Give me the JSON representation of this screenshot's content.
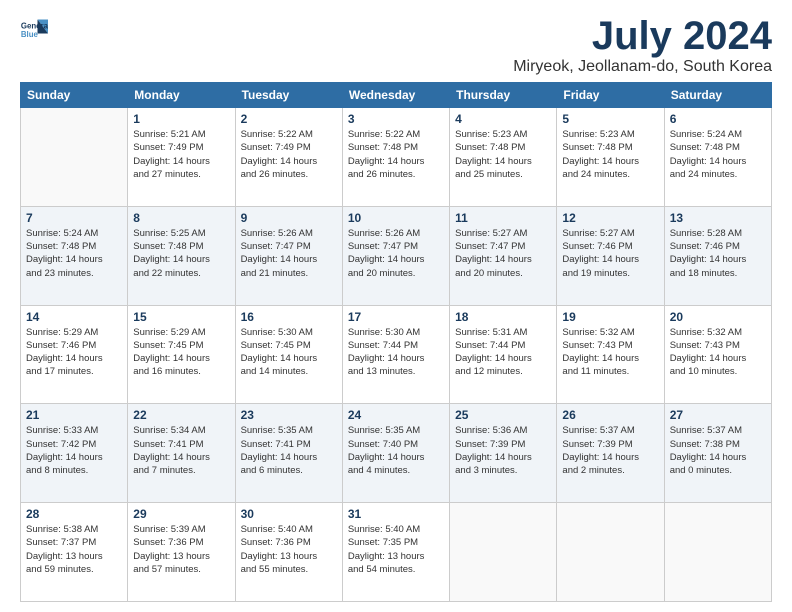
{
  "logo": {
    "line1": "General",
    "line2": "Blue"
  },
  "title": "July 2024",
  "subtitle": "Miryeok, Jeollanam-do, South Korea",
  "weekdays": [
    "Sunday",
    "Monday",
    "Tuesday",
    "Wednesday",
    "Thursday",
    "Friday",
    "Saturday"
  ],
  "weeks": [
    [
      {
        "day": "",
        "info": ""
      },
      {
        "day": "1",
        "info": "Sunrise: 5:21 AM\nSunset: 7:49 PM\nDaylight: 14 hours\nand 27 minutes."
      },
      {
        "day": "2",
        "info": "Sunrise: 5:22 AM\nSunset: 7:49 PM\nDaylight: 14 hours\nand 26 minutes."
      },
      {
        "day": "3",
        "info": "Sunrise: 5:22 AM\nSunset: 7:48 PM\nDaylight: 14 hours\nand 26 minutes."
      },
      {
        "day": "4",
        "info": "Sunrise: 5:23 AM\nSunset: 7:48 PM\nDaylight: 14 hours\nand 25 minutes."
      },
      {
        "day": "5",
        "info": "Sunrise: 5:23 AM\nSunset: 7:48 PM\nDaylight: 14 hours\nand 24 minutes."
      },
      {
        "day": "6",
        "info": "Sunrise: 5:24 AM\nSunset: 7:48 PM\nDaylight: 14 hours\nand 24 minutes."
      }
    ],
    [
      {
        "day": "7",
        "info": "Sunrise: 5:24 AM\nSunset: 7:48 PM\nDaylight: 14 hours\nand 23 minutes."
      },
      {
        "day": "8",
        "info": "Sunrise: 5:25 AM\nSunset: 7:48 PM\nDaylight: 14 hours\nand 22 minutes."
      },
      {
        "day": "9",
        "info": "Sunrise: 5:26 AM\nSunset: 7:47 PM\nDaylight: 14 hours\nand 21 minutes."
      },
      {
        "day": "10",
        "info": "Sunrise: 5:26 AM\nSunset: 7:47 PM\nDaylight: 14 hours\nand 20 minutes."
      },
      {
        "day": "11",
        "info": "Sunrise: 5:27 AM\nSunset: 7:47 PM\nDaylight: 14 hours\nand 20 minutes."
      },
      {
        "day": "12",
        "info": "Sunrise: 5:27 AM\nSunset: 7:46 PM\nDaylight: 14 hours\nand 19 minutes."
      },
      {
        "day": "13",
        "info": "Sunrise: 5:28 AM\nSunset: 7:46 PM\nDaylight: 14 hours\nand 18 minutes."
      }
    ],
    [
      {
        "day": "14",
        "info": "Sunrise: 5:29 AM\nSunset: 7:46 PM\nDaylight: 14 hours\nand 17 minutes."
      },
      {
        "day": "15",
        "info": "Sunrise: 5:29 AM\nSunset: 7:45 PM\nDaylight: 14 hours\nand 16 minutes."
      },
      {
        "day": "16",
        "info": "Sunrise: 5:30 AM\nSunset: 7:45 PM\nDaylight: 14 hours\nand 14 minutes."
      },
      {
        "day": "17",
        "info": "Sunrise: 5:30 AM\nSunset: 7:44 PM\nDaylight: 14 hours\nand 13 minutes."
      },
      {
        "day": "18",
        "info": "Sunrise: 5:31 AM\nSunset: 7:44 PM\nDaylight: 14 hours\nand 12 minutes."
      },
      {
        "day": "19",
        "info": "Sunrise: 5:32 AM\nSunset: 7:43 PM\nDaylight: 14 hours\nand 11 minutes."
      },
      {
        "day": "20",
        "info": "Sunrise: 5:32 AM\nSunset: 7:43 PM\nDaylight: 14 hours\nand 10 minutes."
      }
    ],
    [
      {
        "day": "21",
        "info": "Sunrise: 5:33 AM\nSunset: 7:42 PM\nDaylight: 14 hours\nand 8 minutes."
      },
      {
        "day": "22",
        "info": "Sunrise: 5:34 AM\nSunset: 7:41 PM\nDaylight: 14 hours\nand 7 minutes."
      },
      {
        "day": "23",
        "info": "Sunrise: 5:35 AM\nSunset: 7:41 PM\nDaylight: 14 hours\nand 6 minutes."
      },
      {
        "day": "24",
        "info": "Sunrise: 5:35 AM\nSunset: 7:40 PM\nDaylight: 14 hours\nand 4 minutes."
      },
      {
        "day": "25",
        "info": "Sunrise: 5:36 AM\nSunset: 7:39 PM\nDaylight: 14 hours\nand 3 minutes."
      },
      {
        "day": "26",
        "info": "Sunrise: 5:37 AM\nSunset: 7:39 PM\nDaylight: 14 hours\nand 2 minutes."
      },
      {
        "day": "27",
        "info": "Sunrise: 5:37 AM\nSunset: 7:38 PM\nDaylight: 14 hours\nand 0 minutes."
      }
    ],
    [
      {
        "day": "28",
        "info": "Sunrise: 5:38 AM\nSunset: 7:37 PM\nDaylight: 13 hours\nand 59 minutes."
      },
      {
        "day": "29",
        "info": "Sunrise: 5:39 AM\nSunset: 7:36 PM\nDaylight: 13 hours\nand 57 minutes."
      },
      {
        "day": "30",
        "info": "Sunrise: 5:40 AM\nSunset: 7:36 PM\nDaylight: 13 hours\nand 55 minutes."
      },
      {
        "day": "31",
        "info": "Sunrise: 5:40 AM\nSunset: 7:35 PM\nDaylight: 13 hours\nand 54 minutes."
      },
      {
        "day": "",
        "info": ""
      },
      {
        "day": "",
        "info": ""
      },
      {
        "day": "",
        "info": ""
      }
    ]
  ]
}
